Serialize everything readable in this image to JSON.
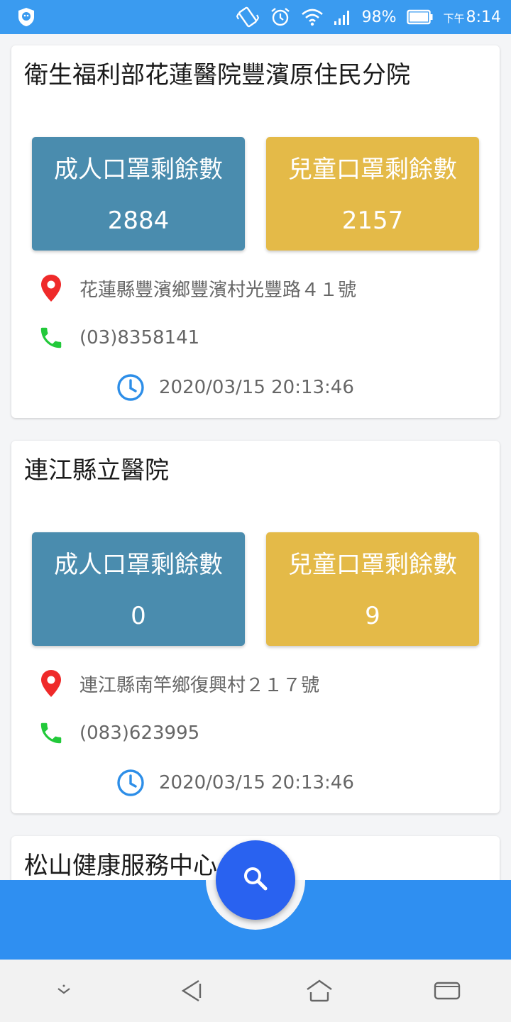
{
  "status_bar": {
    "battery_percent": "98%",
    "ampm": "下午",
    "time": "8:14"
  },
  "labels": {
    "adult": "成人口罩剩餘數",
    "child": "兒童口罩剩餘數"
  },
  "pharmacies": [
    {
      "name": "衛生福利部花蓮醫院豐濱原住民分院",
      "adult_count": "2884",
      "child_count": "2157",
      "address": "花蓮縣豐濱鄉豐濱村光豐路４１號",
      "phone": "(03)8358141",
      "updated": "2020/03/15 20:13:46"
    },
    {
      "name": "連江縣立醫院",
      "adult_count": "0",
      "child_count": "9",
      "address": "連江縣南竿鄉復興村２１７號",
      "phone": "(083)623995",
      "updated": "2020/03/15 20:13:46"
    },
    {
      "name": "松山健康服務中心"
    }
  ],
  "colors": {
    "primary": "#2f8ff1",
    "fab": "#2962f0",
    "adult_box": "#4a8cae",
    "child_box": "#e4ba48",
    "pin": "#ef2a2a",
    "phone": "#22c93a",
    "clock": "#2d8ee8"
  },
  "icons": {
    "status": [
      "shield-app-icon",
      "vibrate-icon",
      "alarm-icon",
      "wifi-icon",
      "signal-icon",
      "battery-icon"
    ],
    "card": [
      "location-pin-icon",
      "phone-icon",
      "clock-icon"
    ],
    "fab": "search-icon",
    "system_nav": [
      "chevron-down-icon",
      "back-icon",
      "home-icon",
      "recents-icon"
    ]
  }
}
